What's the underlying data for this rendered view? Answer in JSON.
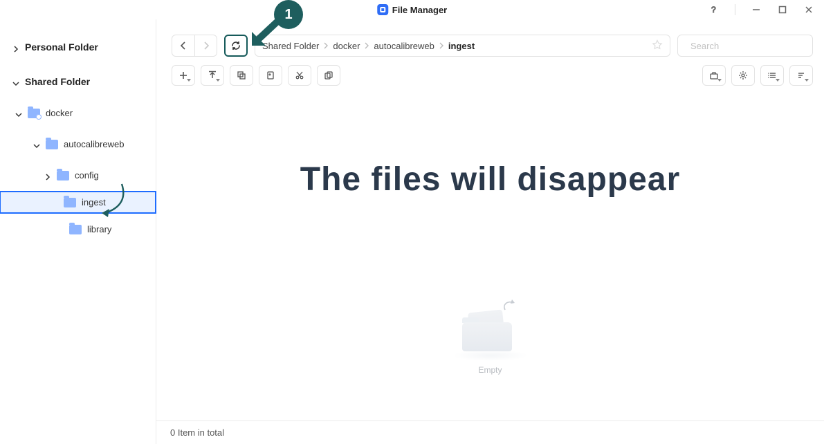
{
  "app": {
    "title": "File Manager"
  },
  "window_controls": {
    "help": "?",
    "minimize": "—",
    "maximize": "☐",
    "close": "✕"
  },
  "sidebar": {
    "roots": [
      {
        "label": "Personal Folder",
        "expanded": false
      },
      {
        "label": "Shared Folder",
        "expanded": true
      }
    ],
    "items": [
      {
        "label": "docker",
        "level": 1,
        "expanded": true,
        "shared": true
      },
      {
        "label": "autocalibreweb",
        "level": 2,
        "expanded": true
      },
      {
        "label": "config",
        "level": 3,
        "expanded": false,
        "has_caret": true
      },
      {
        "label": "ingest",
        "level": 4,
        "selected": true,
        "has_caret": false
      },
      {
        "label": "library",
        "level": 4,
        "has_caret": false
      }
    ]
  },
  "breadcrumb": {
    "segments": [
      "Shared Folder",
      "docker",
      "autocalibreweb",
      "ingest"
    ]
  },
  "search": {
    "placeholder": "Search"
  },
  "empty": {
    "label": "Empty"
  },
  "statusbar": {
    "text": "0 Item in total"
  },
  "annotation": {
    "step": "1",
    "headline": "The files will disappear"
  }
}
